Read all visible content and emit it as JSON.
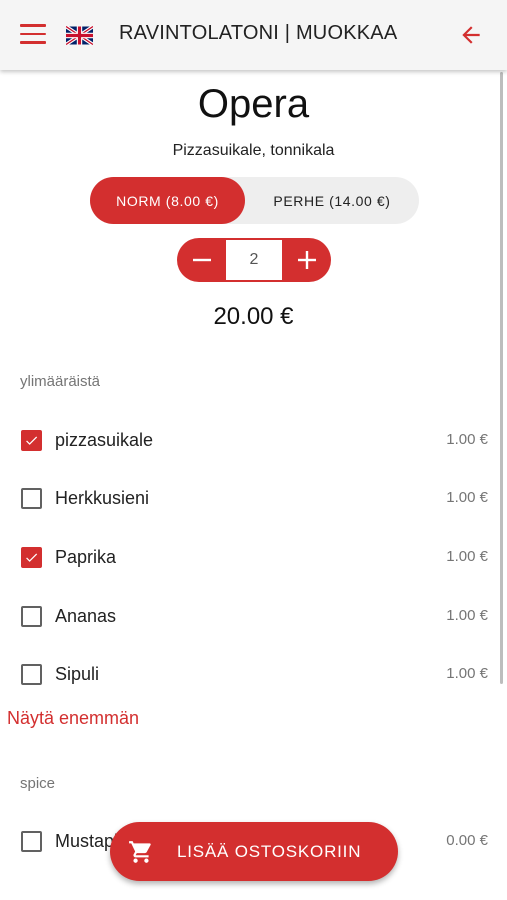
{
  "header": {
    "title": "RAVINTOLATONI | MUOKKAA",
    "menu_icon": "menu-icon",
    "flag_icon": "uk-flag-icon",
    "back_icon": "arrow-left-icon"
  },
  "product": {
    "name": "Opera",
    "description": "Pizzasuikale, tonnikala",
    "sizes": [
      {
        "label": "NORM (8.00 €)",
        "selected": true
      },
      {
        "label": "PERHE (14.00 €)",
        "selected": false
      }
    ],
    "quantity": "2",
    "total": "20.00 €"
  },
  "extras": {
    "label": "ylimääräistä",
    "items": [
      {
        "name": "pizzasuikale",
        "price": "1.00 €",
        "checked": true
      },
      {
        "name": "Herkkusieni",
        "price": "1.00 €",
        "checked": false
      },
      {
        "name": "Paprika",
        "price": "1.00 €",
        "checked": true
      },
      {
        "name": "Ananas",
        "price": "1.00 €",
        "checked": false
      },
      {
        "name": "Sipuli",
        "price": "1.00 €",
        "checked": false
      }
    ],
    "show_more": "Näytä enemmän"
  },
  "spice": {
    "label": "spice",
    "items": [
      {
        "name": "Mustapippuri",
        "price": "0.00 €",
        "checked": false
      }
    ]
  },
  "cart_button": {
    "label": "LISÄÄ OSTOSKORIIN",
    "icon": "cart-icon"
  },
  "colors": {
    "accent": "#d32f2f",
    "appbar": "#f5f5f5",
    "muted_text": "#757575"
  }
}
